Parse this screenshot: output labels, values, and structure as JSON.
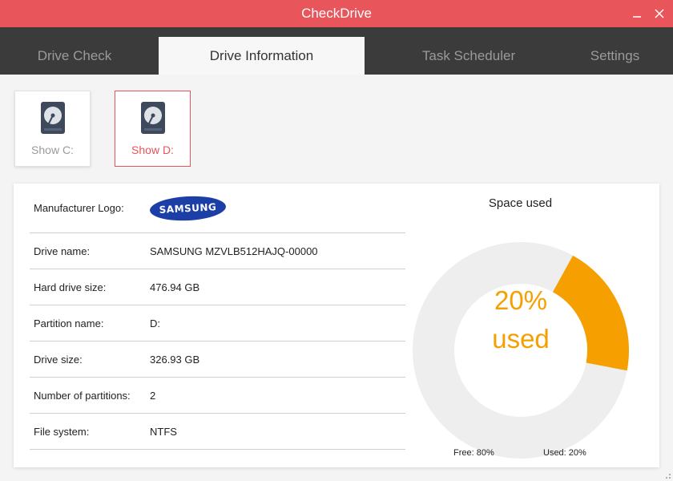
{
  "window": {
    "title": "CheckDrive"
  },
  "colors": {
    "accent": "#e8555a",
    "used": "#f5a000",
    "free": "#eeeeee"
  },
  "tabs": [
    {
      "label": "Drive Check"
    },
    {
      "label": "Drive Information",
      "active": true
    },
    {
      "label": "Task Scheduler"
    },
    {
      "label": "Settings"
    }
  ],
  "drives": [
    {
      "label": "Show C:",
      "icon": "hard-drive-icon"
    },
    {
      "label": "Show D:",
      "icon": "hard-drive-icon",
      "selected": true
    }
  ],
  "info": {
    "manufacturer_logo": {
      "label": "Manufacturer Logo:",
      "logo_text": "SAMSUNG"
    },
    "rows": [
      {
        "label": "Drive name:",
        "value": "SAMSUNG MZVLB512HAJQ-00000"
      },
      {
        "label": "Hard drive size:",
        "value": "476.94 GB"
      },
      {
        "label": "Partition name:",
        "value": "D:"
      },
      {
        "label": "Drive size:",
        "value": "326.93 GB"
      },
      {
        "label": "Number of partitions:",
        "value": "2"
      },
      {
        "label": "File system:",
        "value": "NTFS"
      }
    ]
  },
  "space": {
    "title": "Space used",
    "used_percent_text": "20%",
    "used_word": "used",
    "used_fraction": 0.2,
    "legend_free": "Free: 80%",
    "legend_used": "Used: 20%"
  }
}
